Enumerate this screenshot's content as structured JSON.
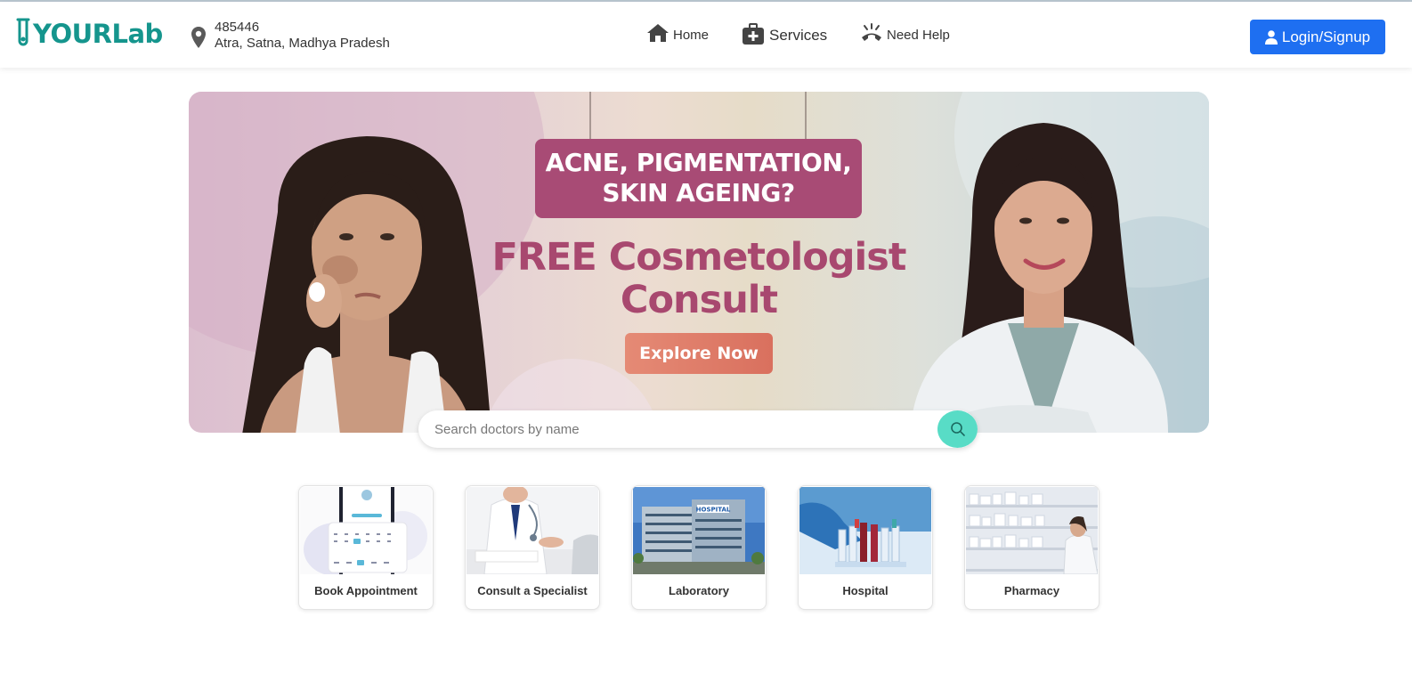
{
  "header": {
    "logo_text": "YOURLab",
    "location": {
      "pincode": "485446",
      "address": "Atra, Satna, Madhya Pradesh"
    },
    "nav": [
      {
        "label": "Home",
        "icon": "home-icon"
      },
      {
        "label": "Services",
        "icon": "medical-kit-icon"
      },
      {
        "label": "Need Help",
        "icon": "phone-ringing-icon"
      }
    ],
    "login_label": "Login/Signup"
  },
  "banner": {
    "headline": "ACNE, PIGMENTATION, SKIN AGEING?",
    "offer_line1": "FREE Cosmetologist",
    "offer_line2": "Consult",
    "cta": "Explore Now"
  },
  "search": {
    "placeholder": "Search doctors by name",
    "value": ""
  },
  "services": [
    {
      "label": "Book Appointment"
    },
    {
      "label": "Consult a Specialist"
    },
    {
      "label": "Laboratory"
    },
    {
      "label": "Hospital"
    },
    {
      "label": "Pharmacy"
    }
  ],
  "colors": {
    "brand": "#15958d",
    "primary_button": "#1e6ff1",
    "banner_accent": "#a84b75",
    "search_button": "#58dcc6"
  }
}
